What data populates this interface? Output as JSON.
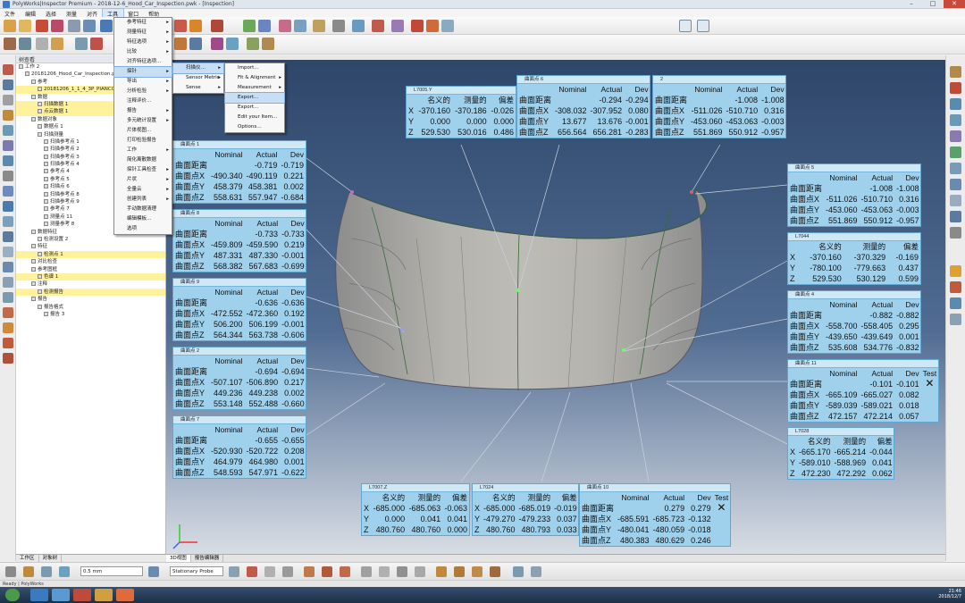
{
  "window": {
    "title": "PolyWorks|Inspector Premium - 2018-12-6_Hood_Car_Inspection.pwk - [Inspection]",
    "minimize": "–",
    "maximize": "□",
    "close": "✕"
  },
  "menubar": [
    "文件",
    "编辑",
    "选择",
    "测量",
    "对齐",
    "工具",
    "窗口",
    "帮助"
  ],
  "menus": {
    "main": [
      {
        "label": "参考特征",
        "arrow": true
      },
      {
        "label": "测量特征",
        "arrow": true
      },
      {
        "label": "特征选项",
        "arrow": true
      },
      {
        "label": "比较",
        "arrow": true
      },
      {
        "label": "对齐特征选项…",
        "arrow": false
      },
      {
        "label": "探针",
        "arrow": true,
        "active": true
      },
      {
        "label": "导出",
        "arrow": true
      },
      {
        "label": "分析检验",
        "arrow": true
      },
      {
        "label": "注释评价…",
        "arrow": false
      },
      {
        "label": "报告",
        "arrow": true
      },
      {
        "label": "多元统计设置",
        "arrow": true
      },
      {
        "label": "片体视图…",
        "arrow": false
      },
      {
        "label": "打印检验报告",
        "arrow": false
      },
      {
        "label": "工作",
        "arrow": true
      },
      {
        "label": "简化离散数据",
        "arrow": false
      },
      {
        "label": "探针工具检查",
        "arrow": true
      },
      {
        "label": "片状",
        "arrow": true
      },
      {
        "label": "全量云",
        "arrow": true
      },
      {
        "label": "创建列表",
        "arrow": true
      },
      {
        "label": "手动数据清理",
        "arrow": false
      },
      {
        "label": "编辑模板…",
        "arrow": false
      },
      {
        "label": "选项",
        "arrow": false
      }
    ],
    "sub1": [
      {
        "label": "扫描仪…",
        "arrow": true,
        "active": true
      },
      {
        "label": "Sensor Metric",
        "arrow": true
      },
      {
        "label": "Sense",
        "arrow": true
      }
    ],
    "sub2": [
      {
        "label": "Import…",
        "arrow": false
      },
      {
        "label": "Fit & Alignment",
        "arrow": true
      },
      {
        "label": "Measurement",
        "arrow": true
      },
      {
        "label": "Export…",
        "arrow": false,
        "active": true
      },
      {
        "label": "Export…",
        "arrow": false
      },
      {
        "label": "Edit your Item…",
        "arrow": false
      },
      {
        "label": "Options…",
        "arrow": false
      }
    ]
  },
  "tree": {
    "header": "树查看",
    "tab_label": "工作区",
    "rows": [
      {
        "t": "工作 2",
        "i": 0,
        "hl": false
      },
      {
        "t": "20181206_Hood_Car_Inspection.pwk - 3",
        "i": 1,
        "hl": false
      },
      {
        "t": "参考",
        "i": 2,
        "hl": false
      },
      {
        "t": "20181206_1_1_4_3P_PIANCO",
        "i": 3,
        "hl": true
      },
      {
        "t": "数据",
        "i": 2,
        "hl": false
      },
      {
        "t": "扫描数据 1",
        "i": 3,
        "hl": true
      },
      {
        "t": "点云数据 1",
        "i": 3,
        "hl": true
      },
      {
        "t": "数据对象",
        "i": 2,
        "hl": false
      },
      {
        "t": "数据点 1",
        "i": 3,
        "hl": false
      },
      {
        "t": "扫描测量",
        "i": 3,
        "hl": false
      },
      {
        "t": "扫描参考点 1",
        "i": 4,
        "hl": false
      },
      {
        "t": "扫描参考点 2",
        "i": 4,
        "hl": false
      },
      {
        "t": "扫描参考点 3",
        "i": 4,
        "hl": false
      },
      {
        "t": "扫描参考点 4",
        "i": 4,
        "hl": false
      },
      {
        "t": "参考点 4",
        "i": 4,
        "hl": false
      },
      {
        "t": "参考点 5",
        "i": 4,
        "hl": false
      },
      {
        "t": "扫描点 6",
        "i": 4,
        "hl": false
      },
      {
        "t": "扫描参考点 8",
        "i": 4,
        "hl": false
      },
      {
        "t": "扫描参考点 9",
        "i": 4,
        "hl": false
      },
      {
        "t": "参考点 7",
        "i": 4,
        "hl": false
      },
      {
        "t": "测量点 11",
        "i": 4,
        "hl": false
      },
      {
        "t": "测量参考 8",
        "i": 4,
        "hl": false
      },
      {
        "t": "数据特征",
        "i": 2,
        "hl": false
      },
      {
        "t": "检测设置 2",
        "i": 3,
        "hl": false
      },
      {
        "t": "特征",
        "i": 2,
        "hl": false
      },
      {
        "t": "检测点 1",
        "i": 3,
        "hl": true
      },
      {
        "t": "对比检查",
        "i": 2,
        "hl": false
      },
      {
        "t": "参考图框",
        "i": 2,
        "hl": false
      },
      {
        "t": "色谱 1",
        "i": 3,
        "hl": true
      },
      {
        "t": "注释",
        "i": 2,
        "hl": false
      },
      {
        "t": "检测报告",
        "i": 3,
        "hl": true
      },
      {
        "t": "报告",
        "i": 2,
        "hl": false
      },
      {
        "t": "报告格式",
        "i": 3,
        "hl": false
      },
      {
        "t": "报告 3",
        "i": 4,
        "hl": false
      }
    ]
  },
  "viewtabs": [
    "3D视图",
    "报告编辑器"
  ],
  "treetabs": [
    "工作区",
    "对象树"
  ],
  "bottombar": {
    "step": "0.5 mm",
    "mode": "Stationary Probe"
  },
  "status": "Ready  | PolyWorks",
  "clock": {
    "time": "21:46",
    "date": "2018/12/7"
  },
  "colors": {
    "panel": "#9fd1ed",
    "panel_header": "#cfe8f6",
    "highlight": "#fff29a"
  },
  "panels": [
    {
      "id": "p-l7005",
      "title": "L7005.Y",
      "cols": [
        "",
        "名义的",
        "测量的",
        "偏差"
      ],
      "rows": [
        [
          "X",
          "-370.160",
          "-370.186",
          "-0.026"
        ],
        [
          "Y",
          "0.000",
          "0.000",
          "0.000"
        ],
        [
          "Z",
          "529.530",
          "530.016",
          "0.486"
        ]
      ]
    },
    {
      "id": "p-top-mid",
      "title": "曲面点 6",
      "cols": [
        "",
        "Nominal",
        "Actual",
        "Dev"
      ],
      "rows": [
        [
          "曲面距离",
          "",
          "-0.294",
          "-0.294"
        ],
        [
          "曲面点X",
          "-308.032",
          "-307.952",
          "0.080"
        ],
        [
          "曲面点Y",
          "13.677",
          "13.676",
          "-0.001"
        ],
        [
          "曲面点Z",
          "656.564",
          "656.281",
          "-0.283"
        ]
      ]
    },
    {
      "id": "p-top-right",
      "title": "2",
      "cols": [
        "",
        "Nominal",
        "Actual",
        "Dev"
      ],
      "rows": [
        [
          "曲面距离",
          "",
          "-1.008",
          "-1.008"
        ],
        [
          "曲面点X",
          "-511.026",
          "-510.710",
          "0.316"
        ],
        [
          "曲面点Y",
          "-453.060",
          "-453.063",
          "-0.003"
        ],
        [
          "曲面点Z",
          "551.869",
          "550.912",
          "-0.957"
        ]
      ]
    },
    {
      "id": "p-l1",
      "title": "曲面点 1",
      "cols": [
        "",
        "Nominal",
        "Actual",
        "Dev"
      ],
      "rows": [
        [
          "曲面距离",
          "",
          "-0.719",
          "-0.719"
        ],
        [
          "曲面点X",
          "-490.340",
          "-490.119",
          "0.221"
        ],
        [
          "曲面点Y",
          "458.379",
          "458.381",
          "0.002"
        ],
        [
          "曲面点Z",
          "558.631",
          "557.947",
          "-0.684"
        ]
      ]
    },
    {
      "id": "p-l2",
      "title": "曲面点 8",
      "cols": [
        "",
        "Nominal",
        "Actual",
        "Dev"
      ],
      "rows": [
        [
          "曲面距离",
          "",
          "-0.733",
          "-0.733"
        ],
        [
          "曲面点X",
          "-459.809",
          "-459.590",
          "0.219"
        ],
        [
          "曲面点Y",
          "487.331",
          "487.330",
          "-0.001"
        ],
        [
          "曲面点Z",
          "568.382",
          "567.683",
          "-0.699"
        ]
      ]
    },
    {
      "id": "p-l3",
      "title": "曲面点 9",
      "cols": [
        "",
        "Nominal",
        "Actual",
        "Dev"
      ],
      "rows": [
        [
          "曲面距离",
          "",
          "-0.636",
          "-0.636"
        ],
        [
          "曲面点X",
          "-472.552",
          "-472.360",
          "0.192"
        ],
        [
          "曲面点Y",
          "506.200",
          "506.199",
          "-0.001"
        ],
        [
          "曲面点Z",
          "564.344",
          "563.738",
          "-0.606"
        ]
      ]
    },
    {
      "id": "p-l4",
      "title": "曲面点 2",
      "cols": [
        "",
        "Nominal",
        "Actual",
        "Dev"
      ],
      "rows": [
        [
          "曲面距离",
          "",
          "-0.694",
          "-0.694"
        ],
        [
          "曲面点X",
          "-507.107",
          "-506.890",
          "0.217"
        ],
        [
          "曲面点Y",
          "449.236",
          "449.238",
          "0.002"
        ],
        [
          "曲面点Z",
          "553.148",
          "552.488",
          "-0.660"
        ]
      ]
    },
    {
      "id": "p-l5",
      "title": "曲面点 7",
      "cols": [
        "",
        "Nominal",
        "Actual",
        "Dev"
      ],
      "rows": [
        [
          "曲面距离",
          "",
          "-0.655",
          "-0.655"
        ],
        [
          "曲面点X",
          "-520.930",
          "-520.722",
          "0.208"
        ],
        [
          "曲面点Y",
          "464.979",
          "464.980",
          "0.001"
        ],
        [
          "曲面点Z",
          "548.593",
          "547.971",
          "-0.622"
        ]
      ]
    },
    {
      "id": "p-r1",
      "title": "曲面点 5",
      "cols": [
        "",
        "Nominal",
        "Actual",
        "Dev"
      ],
      "rows": [
        [
          "曲面距离",
          "",
          "-1.008",
          "-1.008"
        ],
        [
          "曲面点X",
          "-511.026",
          "-510.710",
          "0.316"
        ],
        [
          "曲面点Y",
          "-453.060",
          "-453.063",
          "-0.003"
        ],
        [
          "曲面点Z",
          "551.869",
          "550.912",
          "-0.957"
        ]
      ]
    },
    {
      "id": "p-r2",
      "title": "L7044",
      "cols": [
        "",
        "名义的",
        "测量的",
        "偏差"
      ],
      "rows": [
        [
          "X",
          "-370.160",
          "-370.329",
          "-0.169"
        ],
        [
          "Y",
          "-780.100",
          "-779.663",
          "0.437"
        ],
        [
          "Z",
          "529.530",
          "530.129",
          "0.599"
        ]
      ]
    },
    {
      "id": "p-r3",
      "title": "曲面点 4",
      "cols": [
        "",
        "Nominal",
        "Actual",
        "Dev"
      ],
      "rows": [
        [
          "曲面距离",
          "",
          "-0.882",
          "-0.882"
        ],
        [
          "曲面点X",
          "-558.700",
          "-558.405",
          "0.295"
        ],
        [
          "曲面点Y",
          "-439.650",
          "-439.649",
          "0.001"
        ],
        [
          "曲面点Z",
          "535.608",
          "534.776",
          "-0.832"
        ]
      ]
    },
    {
      "id": "p-r4",
      "title": "曲面点 11",
      "cols": [
        "",
        "Nominal",
        "Actual",
        "Dev",
        "Test"
      ],
      "x": "✕",
      "rows": [
        [
          "曲面距离",
          "",
          "-0.101",
          "-0.101"
        ],
        [
          "曲面点X",
          "-665.109",
          "-665.027",
          "0.082"
        ],
        [
          "曲面点Y",
          "-589.039",
          "-589.021",
          "0.018"
        ],
        [
          "曲面点Z",
          "472.157",
          "472.214",
          "0.057"
        ]
      ]
    },
    {
      "id": "p-r5",
      "title": "L7028",
      "cols": [
        "",
        "名义的",
        "测量的",
        "偏差"
      ],
      "rows": [
        [
          "X",
          "-665.170",
          "-665.214",
          "-0.044"
        ],
        [
          "Y",
          "-589.010",
          "-588.969",
          "0.041"
        ],
        [
          "Z",
          "472.230",
          "472.292",
          "0.062"
        ]
      ]
    },
    {
      "id": "p-b1",
      "title": "L7007.Z",
      "cols": [
        "",
        "名义的",
        "测量的",
        "偏差"
      ],
      "rows": [
        [
          "X",
          "-685.000",
          "-685.063",
          "-0.063"
        ],
        [
          "Y",
          "0.000",
          "0.041",
          "0.041"
        ],
        [
          "Z",
          "480.760",
          "480.760",
          "0.000"
        ]
      ]
    },
    {
      "id": "p-b2",
      "title": "L7024",
      "cols": [
        "",
        "名义的",
        "测量的",
        "偏差"
      ],
      "rows": [
        [
          "X",
          "-685.000",
          "-685.019",
          "-0.019"
        ],
        [
          "Y",
          "-479.270",
          "-479.233",
          "0.037"
        ],
        [
          "Z",
          "480.760",
          "480.793",
          "0.033"
        ]
      ]
    },
    {
      "id": "p-b3",
      "title": "曲面点 10",
      "cols": [
        "",
        "Nominal",
        "Actual",
        "Dev",
        "Test"
      ],
      "x": "✕",
      "rows": [
        [
          "曲面距离",
          "",
          "0.279",
          "0.279"
        ],
        [
          "曲面点X",
          "-685.591",
          "-685.723",
          "-0.132"
        ],
        [
          "曲面点Y",
          "-480.041",
          "-480.059",
          "-0.018"
        ],
        [
          "曲面点Z",
          "480.383",
          "480.629",
          "0.246"
        ]
      ]
    }
  ]
}
